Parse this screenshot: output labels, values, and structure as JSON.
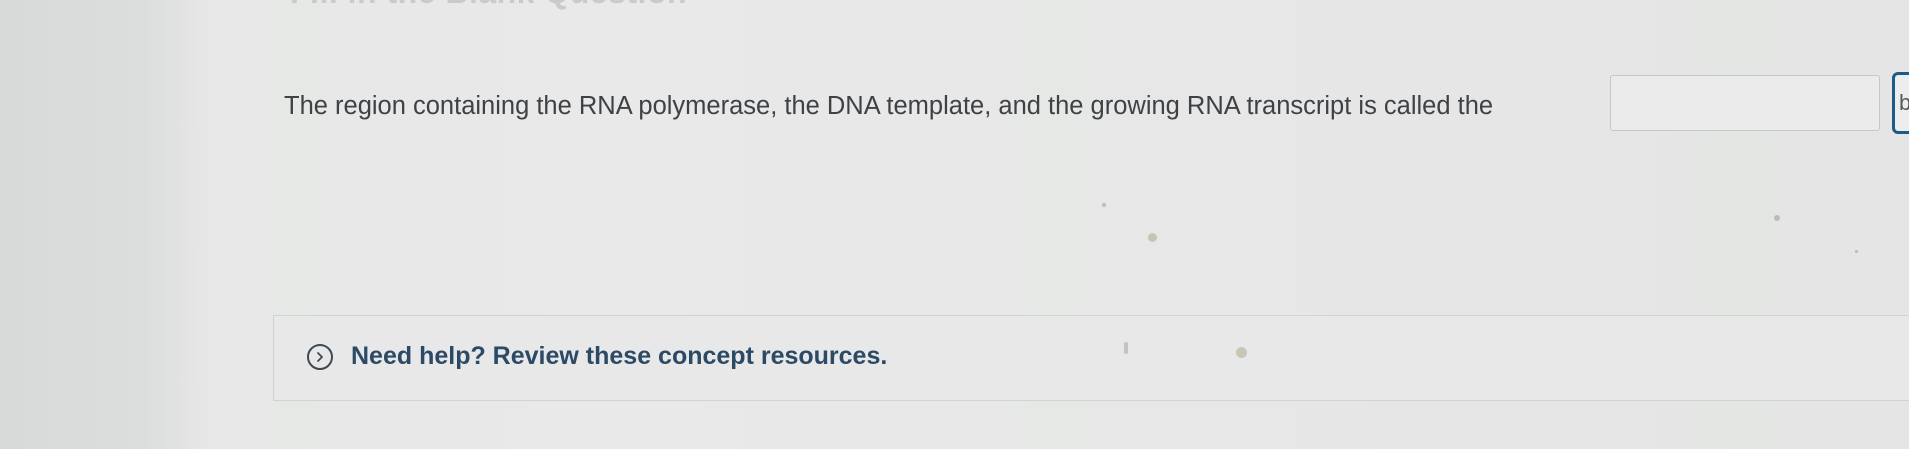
{
  "header": {
    "title": "Fill in the Blank Question"
  },
  "question": {
    "text": "The region containing the RNA polymerase, the DNA template, and the growing RNA transcript is called the",
    "answer_value": "",
    "answer_placeholder": "",
    "next_blank_label": "b"
  },
  "help": {
    "label": "Need help? Review these concept resources.",
    "icon": "chevron-right-circle-icon"
  },
  "colors": {
    "link_text": "#2c4a66",
    "active_blank_border": "#1f5a86",
    "input_border": "#c4c8cb"
  }
}
